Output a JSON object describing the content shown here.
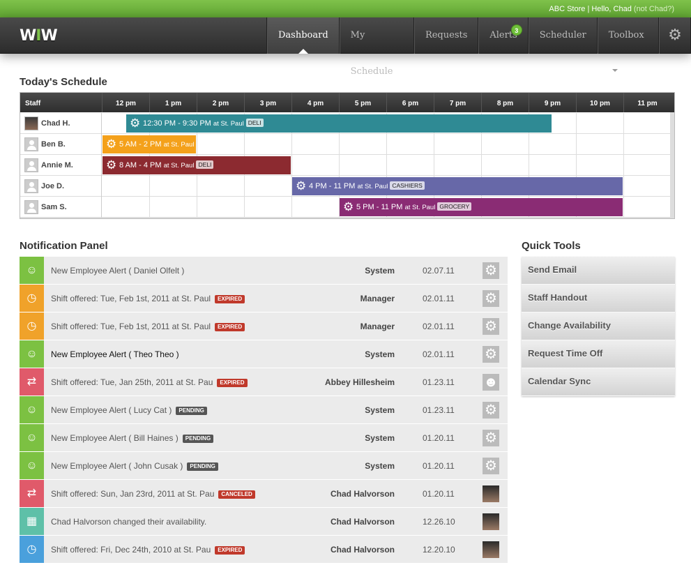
{
  "topbar": {
    "store": "ABC Store",
    "separator": "|",
    "greeting": "Hello, Chad",
    "not_user": "(not Chad?)"
  },
  "nav": {
    "logo_left": "W",
    "logo_mid": "I",
    "logo_right": "W",
    "tabs": [
      {
        "label": "Dashboard",
        "active": true
      },
      {
        "label": "My Schedule"
      },
      {
        "label": "Requests"
      },
      {
        "label": "Alerts",
        "badge": "3"
      },
      {
        "label": "Scheduler"
      },
      {
        "label": "Toolbox"
      }
    ],
    "settings_icon": "gear-icon"
  },
  "schedule": {
    "title": "Today's Schedule",
    "staff_header": "Staff",
    "hours": [
      "12 pm",
      "1 pm",
      "2 pm",
      "3 pm",
      "4 pm",
      "5 pm",
      "6 pm",
      "7 pm",
      "8 pm",
      "9 pm",
      "10 pm",
      "11 pm"
    ],
    "rows": [
      {
        "name": "Chad H.",
        "avatar": "photo",
        "shift": {
          "time": "12:30 PM - 9:30 PM",
          "at": "at St. Paul",
          "dept": "DELI",
          "color": "#2f8a94",
          "start": 12.5,
          "end": 21.5
        }
      },
      {
        "name": "Ben B.",
        "avatar": "blank",
        "shift": {
          "time": "5 AM - 2 PM",
          "at": "at St. Paul",
          "dept": "",
          "color": "#f4a11b",
          "start": 12,
          "end": 14
        }
      },
      {
        "name": "Annie M.",
        "avatar": "blank",
        "shift": {
          "time": "8 AM - 4 PM",
          "at": "at St. Paul",
          "dept": "DELI",
          "color": "#8c2a30",
          "start": 12,
          "end": 16
        }
      },
      {
        "name": "Joe D.",
        "avatar": "blank",
        "shift": {
          "time": "4 PM - 11 PM",
          "at": "at St. Paul",
          "dept": "CASHIERS",
          "color": "#6768a8",
          "start": 16,
          "end": 23
        }
      },
      {
        "name": "Sam S.",
        "avatar": "blank",
        "shift": {
          "time": "5 PM - 11 PM",
          "at": "at St. Paul",
          "dept": "GROCERY",
          "color": "#8a2c74",
          "start": 17,
          "end": 23
        }
      }
    ]
  },
  "notifications": {
    "title": "Notification Panel",
    "items": [
      {
        "text": "New Employee Alert ( Daniel Olfelt )",
        "status": "",
        "from": "System",
        "date": "02.07.11",
        "icon": "employee-icon",
        "color": "#7cc142",
        "thumb": "gear"
      },
      {
        "text": "Shift offered: Tue, Feb 1st, 2011 at St. Paul",
        "status": "EXPIRED",
        "from": "Manager",
        "date": "02.01.11",
        "icon": "clock-offer-icon",
        "color": "#f0a22a",
        "thumb": "gear"
      },
      {
        "text": "Shift offered: Tue, Feb 1st, 2011 at St. Paul",
        "status": "EXPIRED",
        "from": "Manager",
        "date": "02.01.11",
        "icon": "clock-offer-icon",
        "color": "#f0a22a",
        "thumb": "gear"
      },
      {
        "text": "New Employee Alert ( Theo Theo )",
        "status": "",
        "from": "System",
        "date": "02.01.11",
        "icon": "employee-icon",
        "color": "#7cc142",
        "thumb": "gear",
        "dark": true
      },
      {
        "text": "Shift offered: Tue, Jan 25th, 2011 at St. Pau",
        "status": "EXPIRED",
        "from": "Abbey Hillesheim",
        "date": "01.23.11",
        "icon": "swap-icon",
        "color": "#e05a6a",
        "thumb": "person"
      },
      {
        "text": "New Employee Alert ( Lucy Cat )",
        "status": "PENDING",
        "from": "System",
        "date": "01.23.11",
        "icon": "employee-icon",
        "color": "#7cc142",
        "thumb": "gear"
      },
      {
        "text": "New Employee Alert ( Bill Haines )",
        "status": "PENDING",
        "from": "System",
        "date": "01.20.11",
        "icon": "employee-icon",
        "color": "#7cc142",
        "thumb": "gear"
      },
      {
        "text": "New Employee Alert ( John Cusak )",
        "status": "PENDING",
        "from": "System",
        "date": "01.20.11",
        "icon": "employee-icon",
        "color": "#7cc142",
        "thumb": "gear"
      },
      {
        "text": "Shift offered: Sun, Jan 23rd, 2011 at St. Pau",
        "status": "CANCELED",
        "from": "Chad Halvorson",
        "date": "01.20.11",
        "icon": "swap-icon",
        "color": "#e05a6a",
        "thumb": "photo"
      },
      {
        "text": "Chad Halvorson changed their availability.",
        "status": "",
        "from": "Chad Halvorson",
        "date": "12.26.10",
        "icon": "calendar-icon",
        "color": "#5ec0a8",
        "thumb": "photo"
      },
      {
        "text": "Shift offered: Fri, Dec 24th, 2010 at St. Pau",
        "status": "EXPIRED",
        "from": "Chad Halvorson",
        "date": "12.20.10",
        "icon": "clock-download-icon",
        "color": "#4aa0dc",
        "thumb": "photo"
      }
    ]
  },
  "quick_tools": {
    "title": "Quick Tools",
    "buttons": [
      "Send Email",
      "Staff Handout",
      "Change Availability",
      "Request Time Off",
      "Calendar Sync"
    ]
  }
}
